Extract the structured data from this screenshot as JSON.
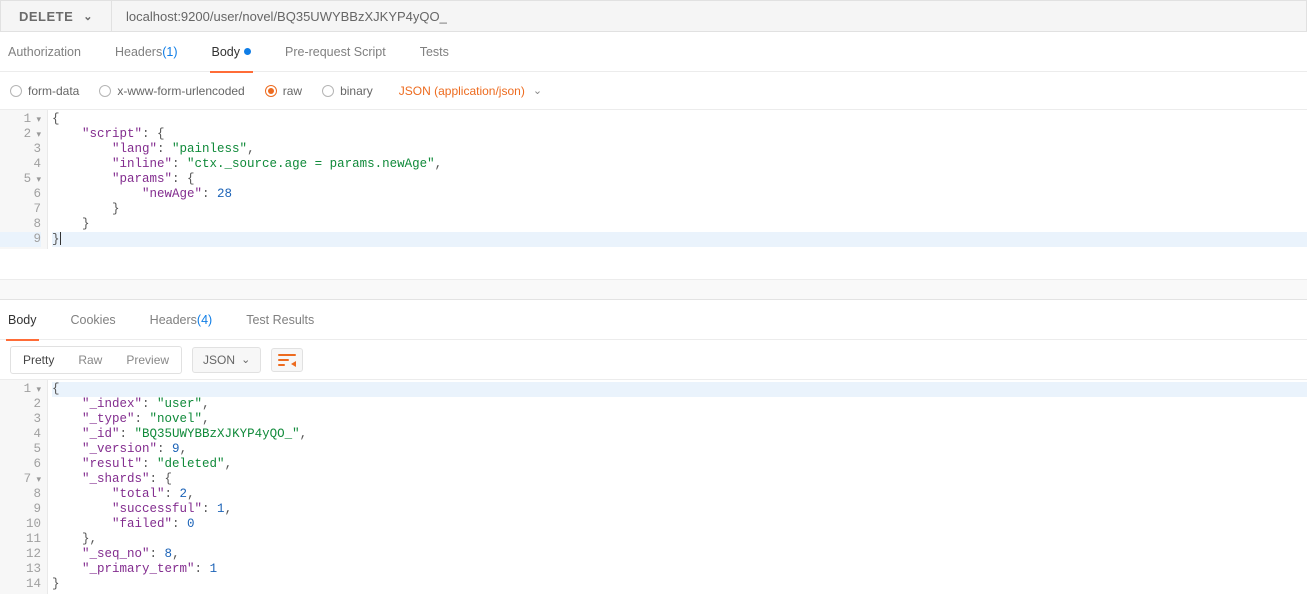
{
  "request": {
    "method": "DELETE",
    "url": "localhost:9200/user/novel/BQ35UWYBBzXJKYP4yQO_"
  },
  "request_tabs": [
    {
      "key": "authorization",
      "label": "Authorization",
      "active": false
    },
    {
      "key": "headers",
      "label": "Headers",
      "count": "(1)",
      "active": false
    },
    {
      "key": "body",
      "label": "Body",
      "indicator": true,
      "active": true
    },
    {
      "key": "prerequest",
      "label": "Pre-request Script",
      "active": false
    },
    {
      "key": "tests",
      "label": "Tests",
      "active": false
    }
  ],
  "body_options": {
    "radios": [
      {
        "key": "form-data",
        "label": "form-data",
        "selected": false
      },
      {
        "key": "x-www",
        "label": "x-www-form-urlencoded",
        "selected": false
      },
      {
        "key": "raw",
        "label": "raw",
        "selected": true
      },
      {
        "key": "binary",
        "label": "binary",
        "selected": false
      }
    ],
    "content_type": "JSON (application/json)"
  },
  "request_body_lines": [
    {
      "n": 1,
      "fold": true,
      "tokens": [
        {
          "t": "{",
          "c": "s-punc"
        }
      ]
    },
    {
      "n": 2,
      "fold": true,
      "indent": 4,
      "tokens": [
        {
          "t": "\"script\"",
          "c": "s-key"
        },
        {
          "t": ": ",
          "c": "s-punc"
        },
        {
          "t": "{",
          "c": "s-punc"
        }
      ]
    },
    {
      "n": 3,
      "indent": 8,
      "tokens": [
        {
          "t": "\"lang\"",
          "c": "s-key"
        },
        {
          "t": ": ",
          "c": "s-punc"
        },
        {
          "t": "\"painless\"",
          "c": "s-str"
        },
        {
          "t": ",",
          "c": "s-punc"
        }
      ]
    },
    {
      "n": 4,
      "indent": 8,
      "tokens": [
        {
          "t": "\"inline\"",
          "c": "s-key"
        },
        {
          "t": ": ",
          "c": "s-punc"
        },
        {
          "t": "\"ctx._source.age = params.newAge\"",
          "c": "s-str"
        },
        {
          "t": ",",
          "c": "s-punc"
        }
      ]
    },
    {
      "n": 5,
      "fold": true,
      "indent": 8,
      "tokens": [
        {
          "t": "\"params\"",
          "c": "s-key"
        },
        {
          "t": ": ",
          "c": "s-punc"
        },
        {
          "t": "{",
          "c": "s-punc"
        }
      ]
    },
    {
      "n": 6,
      "indent": 12,
      "tokens": [
        {
          "t": "\"newAge\"",
          "c": "s-key"
        },
        {
          "t": ": ",
          "c": "s-punc"
        },
        {
          "t": "28",
          "c": "s-num"
        }
      ]
    },
    {
      "n": 7,
      "indent": 8,
      "tokens": [
        {
          "t": "}",
          "c": "s-punc"
        }
      ]
    },
    {
      "n": 8,
      "indent": 4,
      "tokens": [
        {
          "t": "}",
          "c": "s-punc"
        }
      ]
    },
    {
      "n": 9,
      "last": true,
      "tokens": [
        {
          "t": "}",
          "c": "s-punc"
        }
      ],
      "cursor": true
    }
  ],
  "response_tabs": [
    {
      "key": "body",
      "label": "Body",
      "active": true
    },
    {
      "key": "cookies",
      "label": "Cookies",
      "active": false
    },
    {
      "key": "headers",
      "label": "Headers",
      "count": "(4)",
      "active": false
    },
    {
      "key": "tests",
      "label": "Test Results",
      "active": false
    }
  ],
  "response_view_modes": [
    {
      "key": "pretty",
      "label": "Pretty",
      "active": true
    },
    {
      "key": "raw",
      "label": "Raw",
      "active": false
    },
    {
      "key": "preview",
      "label": "Preview",
      "active": false
    }
  ],
  "response_format": "JSON",
  "response_body_lines": [
    {
      "n": 1,
      "fold": true,
      "first": true,
      "tokens": [
        {
          "t": "{",
          "c": "s-punc"
        }
      ]
    },
    {
      "n": 2,
      "indent": 4,
      "tokens": [
        {
          "t": "\"_index\"",
          "c": "s-key"
        },
        {
          "t": ": ",
          "c": "s-punc"
        },
        {
          "t": "\"user\"",
          "c": "s-str"
        },
        {
          "t": ",",
          "c": "s-punc"
        }
      ]
    },
    {
      "n": 3,
      "indent": 4,
      "tokens": [
        {
          "t": "\"_type\"",
          "c": "s-key"
        },
        {
          "t": ": ",
          "c": "s-punc"
        },
        {
          "t": "\"novel\"",
          "c": "s-str"
        },
        {
          "t": ",",
          "c": "s-punc"
        }
      ]
    },
    {
      "n": 4,
      "indent": 4,
      "tokens": [
        {
          "t": "\"_id\"",
          "c": "s-key"
        },
        {
          "t": ": ",
          "c": "s-punc"
        },
        {
          "t": "\"BQ35UWYBBzXJKYP4yQO_\"",
          "c": "s-str"
        },
        {
          "t": ",",
          "c": "s-punc"
        }
      ]
    },
    {
      "n": 5,
      "indent": 4,
      "tokens": [
        {
          "t": "\"_version\"",
          "c": "s-key"
        },
        {
          "t": ": ",
          "c": "s-punc"
        },
        {
          "t": "9",
          "c": "s-num"
        },
        {
          "t": ",",
          "c": "s-punc"
        }
      ]
    },
    {
      "n": 6,
      "indent": 4,
      "tokens": [
        {
          "t": "\"result\"",
          "c": "s-key"
        },
        {
          "t": ": ",
          "c": "s-punc"
        },
        {
          "t": "\"deleted\"",
          "c": "s-str"
        },
        {
          "t": ",",
          "c": "s-punc"
        }
      ]
    },
    {
      "n": 7,
      "fold": true,
      "indent": 4,
      "tokens": [
        {
          "t": "\"_shards\"",
          "c": "s-key"
        },
        {
          "t": ": ",
          "c": "s-punc"
        },
        {
          "t": "{",
          "c": "s-punc"
        }
      ]
    },
    {
      "n": 8,
      "indent": 8,
      "tokens": [
        {
          "t": "\"total\"",
          "c": "s-key"
        },
        {
          "t": ": ",
          "c": "s-punc"
        },
        {
          "t": "2",
          "c": "s-num"
        },
        {
          "t": ",",
          "c": "s-punc"
        }
      ]
    },
    {
      "n": 9,
      "indent": 8,
      "tokens": [
        {
          "t": "\"successful\"",
          "c": "s-key"
        },
        {
          "t": ": ",
          "c": "s-punc"
        },
        {
          "t": "1",
          "c": "s-num"
        },
        {
          "t": ",",
          "c": "s-punc"
        }
      ]
    },
    {
      "n": 10,
      "indent": 8,
      "tokens": [
        {
          "t": "\"failed\"",
          "c": "s-key"
        },
        {
          "t": ": ",
          "c": "s-punc"
        },
        {
          "t": "0",
          "c": "s-num"
        }
      ]
    },
    {
      "n": 11,
      "indent": 4,
      "tokens": [
        {
          "t": "}",
          "c": "s-punc"
        },
        {
          "t": ",",
          "c": "s-punc"
        }
      ]
    },
    {
      "n": 12,
      "indent": 4,
      "tokens": [
        {
          "t": "\"_seq_no\"",
          "c": "s-key"
        },
        {
          "t": ": ",
          "c": "s-punc"
        },
        {
          "t": "8",
          "c": "s-num"
        },
        {
          "t": ",",
          "c": "s-punc"
        }
      ]
    },
    {
      "n": 13,
      "indent": 4,
      "tokens": [
        {
          "t": "\"_primary_term\"",
          "c": "s-key"
        },
        {
          "t": ": ",
          "c": "s-punc"
        },
        {
          "t": "1",
          "c": "s-num"
        }
      ]
    },
    {
      "n": 14,
      "tokens": [
        {
          "t": "}",
          "c": "s-punc"
        }
      ]
    }
  ]
}
